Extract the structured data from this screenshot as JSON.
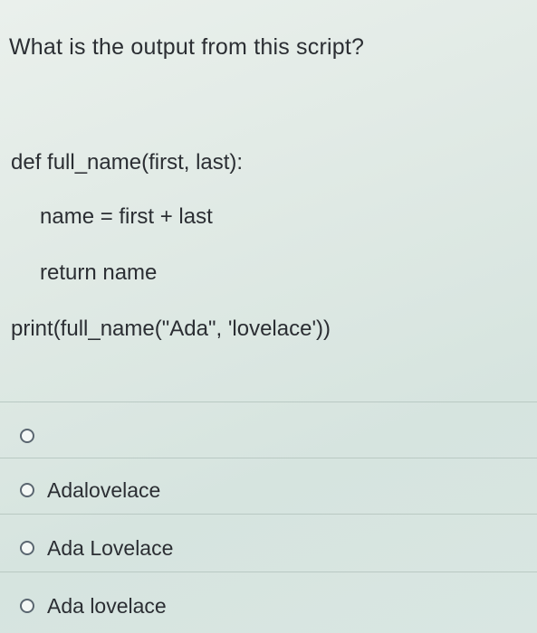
{
  "question": {
    "text": "What is the output from this script?"
  },
  "code": {
    "line1": "def full_name(first, last):",
    "line2": "name = first + last",
    "line3": "return name",
    "line4": "print(full_name(\"Ada\", 'lovelace'))"
  },
  "options": [
    {
      "label": ""
    },
    {
      "label": "Adalovelace"
    },
    {
      "label": "Ada Lovelace"
    },
    {
      "label": "Ada lovelace"
    }
  ]
}
